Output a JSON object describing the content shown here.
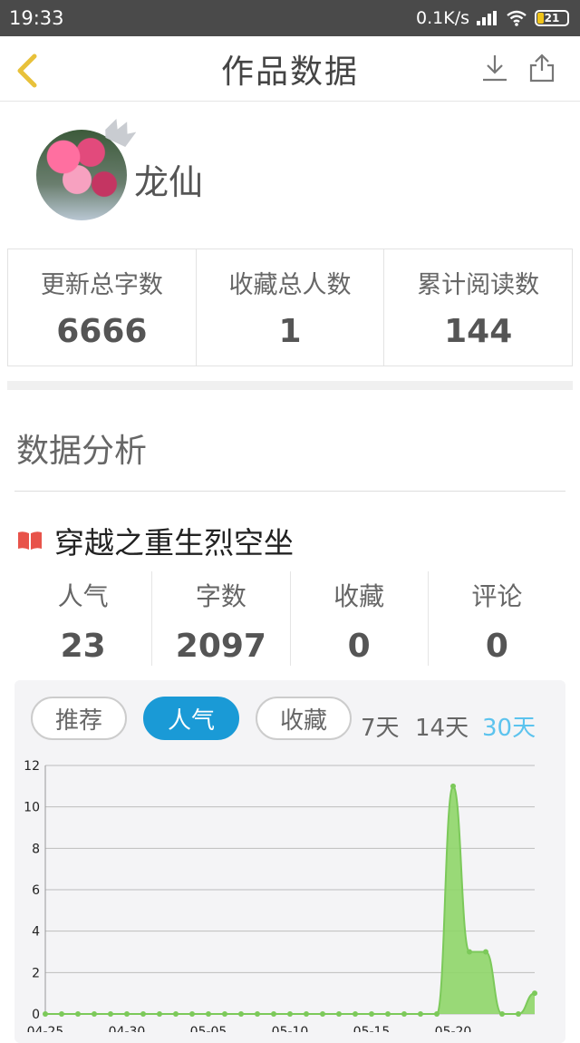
{
  "status_bar": {
    "time": "19:33",
    "network_speed": "0.1K/s",
    "battery": "21"
  },
  "header": {
    "title": "作品数据"
  },
  "profile": {
    "username": "龙仙"
  },
  "totals": [
    {
      "label": "更新总字数",
      "value": "6666"
    },
    {
      "label": "收藏总人数",
      "value": "1"
    },
    {
      "label": "累计阅读数",
      "value": "144"
    }
  ],
  "analysis": {
    "title": "数据分析"
  },
  "book": {
    "name": "穿越之重生烈空坐",
    "stats": [
      {
        "label": "人气",
        "value": "23"
      },
      {
        "label": "字数",
        "value": "2097"
      },
      {
        "label": "收藏",
        "value": "0"
      },
      {
        "label": "评论",
        "value": "0"
      }
    ]
  },
  "tabs": [
    {
      "label": "推荐",
      "active": false
    },
    {
      "label": "人气",
      "active": true
    },
    {
      "label": "收藏",
      "active": false
    }
  ],
  "ranges": [
    {
      "label": "7天",
      "active": false
    },
    {
      "label": "14天",
      "active": false
    },
    {
      "label": "30天",
      "active": true
    }
  ],
  "colors": {
    "accent": "#1a9ad6",
    "range_active": "#5cc3ee",
    "chart_fill": "#8fd669",
    "chart_line": "#7cc95a"
  },
  "chart_data": {
    "type": "area",
    "x_tick_labels": [
      "04-25",
      "04-30",
      "05-05",
      "05-10",
      "05-15",
      "05-20"
    ],
    "y_ticks": [
      0,
      2,
      4,
      6,
      8,
      10,
      12
    ],
    "ylim": [
      0,
      12
    ],
    "grid": true,
    "series": [
      {
        "values": [
          0,
          0,
          0,
          0,
          0,
          0,
          0,
          0,
          0,
          0,
          0,
          0,
          0,
          0,
          0,
          0,
          0,
          0,
          0,
          0,
          0,
          0,
          0,
          0,
          0,
          11,
          3,
          3,
          0,
          0,
          1
        ]
      }
    ]
  }
}
